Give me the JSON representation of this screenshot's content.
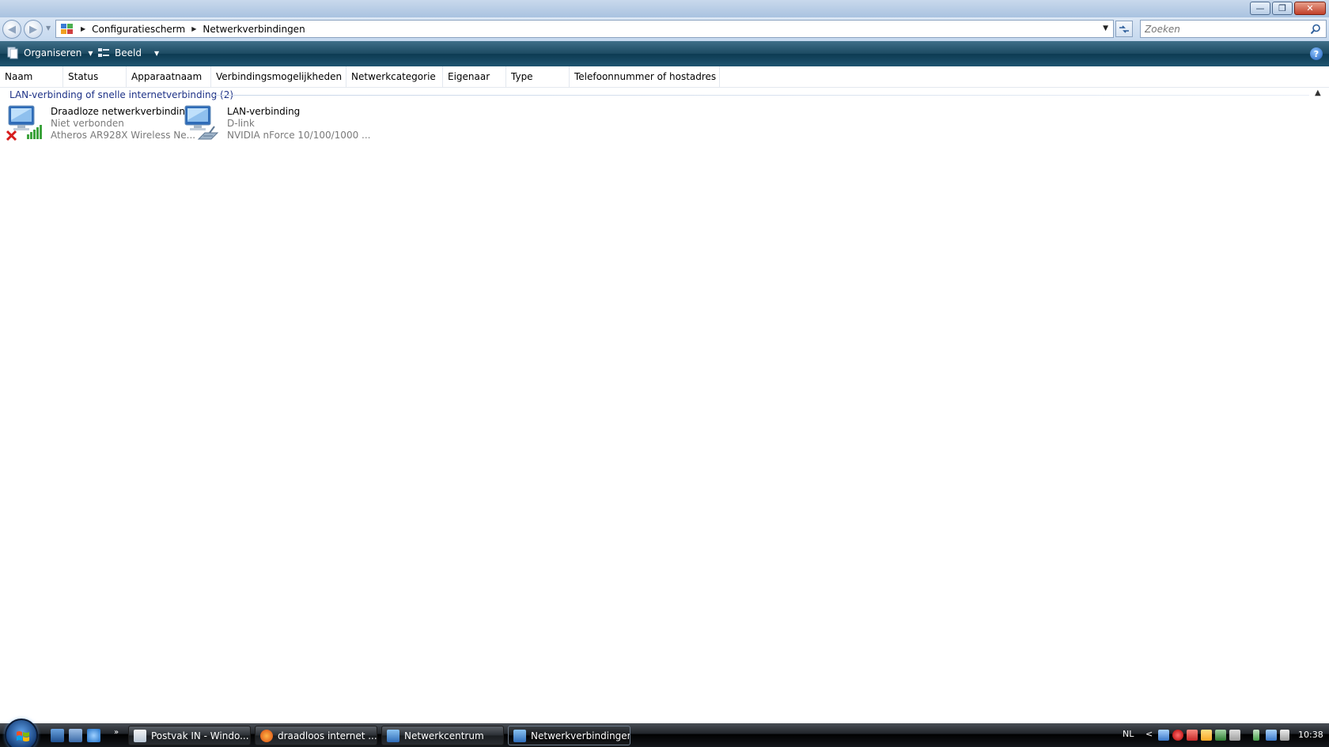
{
  "window": {
    "minimize": "—",
    "restore": "❐",
    "close": "✕"
  },
  "nav": {
    "back_glyph": "◀",
    "forward_glyph": "▶",
    "breadcrumb": [
      "Configuratiescherm",
      "Netwerkverbindingen"
    ],
    "search_placeholder": "Zoeken"
  },
  "toolbar": {
    "organize_label": "Organiseren",
    "view_label": "Beeld",
    "help_glyph": "?"
  },
  "columns": [
    "Naam",
    "Status",
    "Apparaatnaam",
    "Verbindingsmogelijkheden",
    "Netwerkcategorie",
    "Eigenaar",
    "Type",
    "Telefoonnummer of hostadres"
  ],
  "group": {
    "label": "LAN-verbinding of snelle internetverbinding (2)"
  },
  "items": [
    {
      "name": "Draadloze netwerkverbinding",
      "status": "Niet verbonden",
      "device": "Atheros AR928X Wireless Ne..."
    },
    {
      "name": "LAN-verbinding",
      "status": "D-link",
      "device": "NVIDIA nForce 10/100/1000 ..."
    }
  ],
  "taskbar": {
    "more_glyph": "»",
    "buttons": [
      {
        "label": "Postvak IN - Windo..."
      },
      {
        "label": "draadloos internet ..."
      },
      {
        "label": "Netwerkcentrum"
      },
      {
        "label": "Netwerkverbindingen"
      }
    ],
    "language": "NL",
    "tray_arrow": "<",
    "clock": "10:38"
  },
  "colors": {
    "command_bar": "#1c4a62",
    "group_header_text": "#1e3287",
    "secondary_text": "#7a7a7a"
  }
}
